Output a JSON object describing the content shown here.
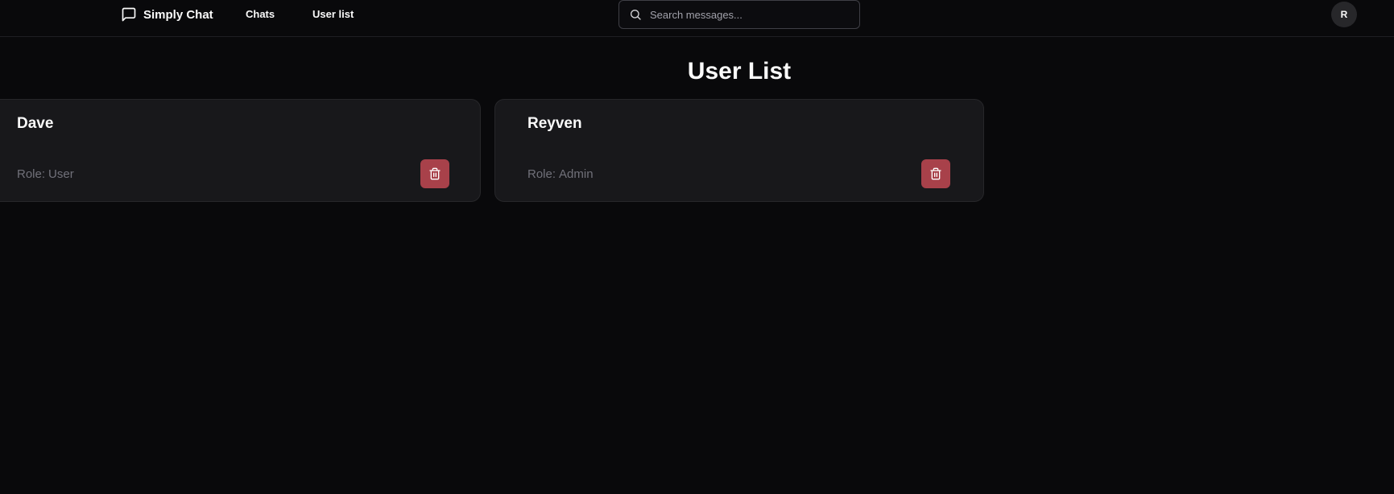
{
  "header": {
    "brand": {
      "icon": "message-square-icon",
      "label": "Simply Chat"
    },
    "nav": [
      {
        "label": "Chats"
      },
      {
        "label": "User list"
      }
    ],
    "search": {
      "icon": "search-icon",
      "placeholder": "Search messages...",
      "value": ""
    },
    "avatar": {
      "initial": "R"
    }
  },
  "main": {
    "title": "User List",
    "role_prefix": "Role:",
    "users": [
      {
        "name": "Dave",
        "role": "User",
        "delete_icon": "trash-icon"
      },
      {
        "name": "Reyven",
        "role": "Admin",
        "delete_icon": "trash-icon"
      }
    ]
  },
  "colors": {
    "background": "#09090b",
    "card": "#18181b",
    "card_border": "#27272a",
    "muted_text": "#71717a",
    "delete_button": "#a8414a"
  }
}
